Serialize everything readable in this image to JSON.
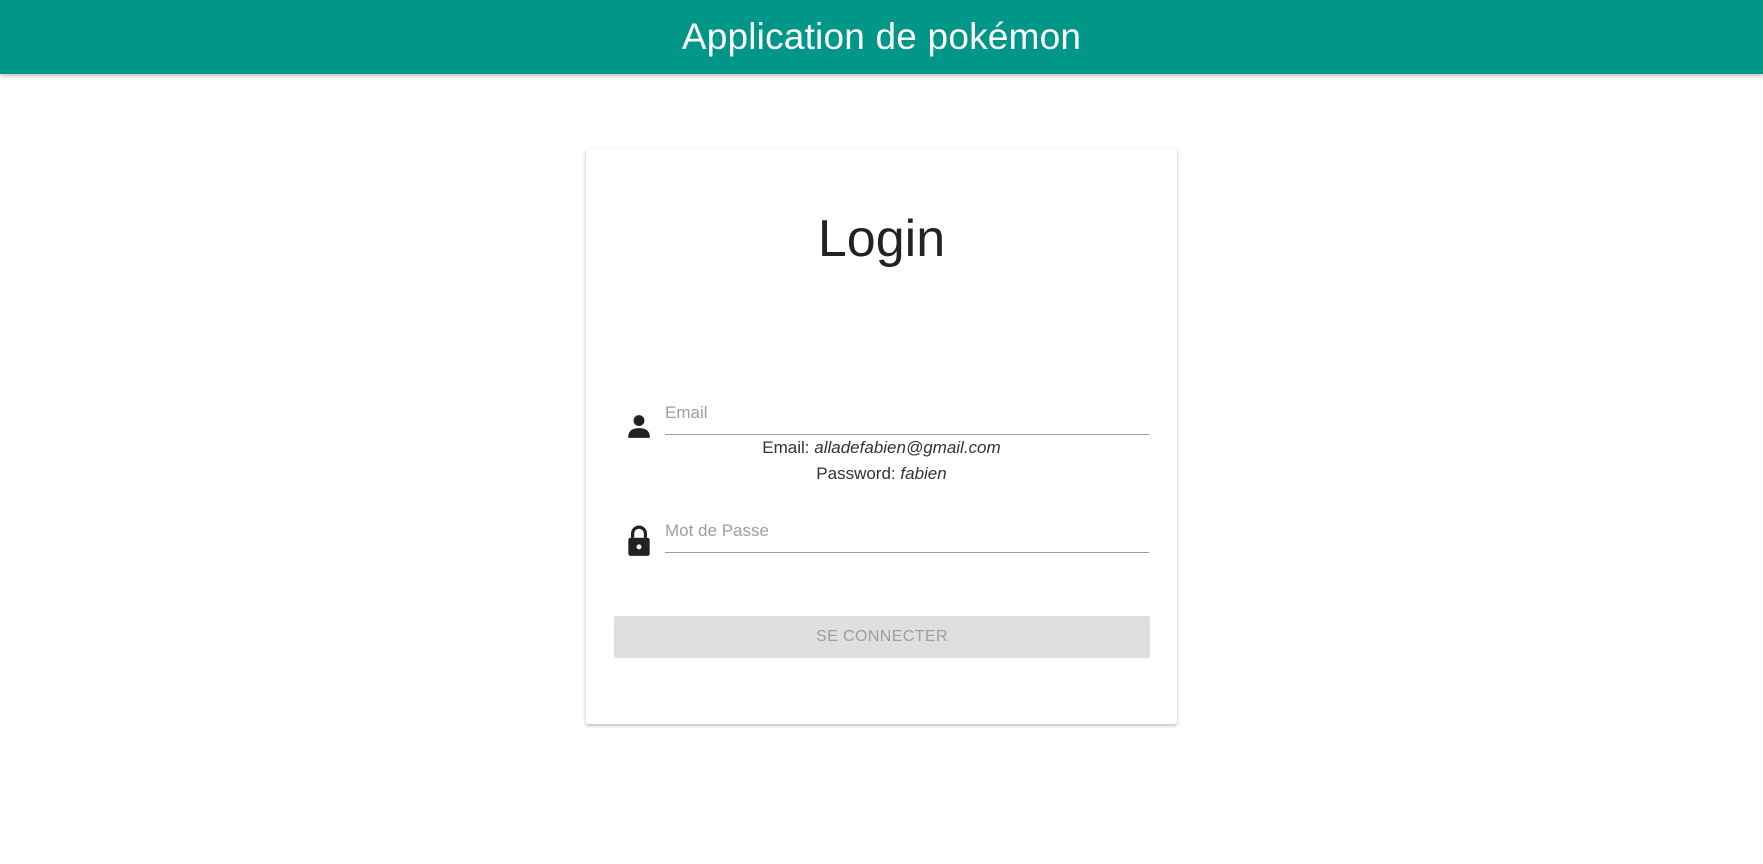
{
  "header": {
    "title": "Application de pokémon",
    "background_color": "#009688"
  },
  "login_card": {
    "title": "Login",
    "email_hint_label": "Email:",
    "email_hint_value": "alladefabien@gmail.com",
    "password_hint_label": "Password:",
    "password_hint_value": "fabien",
    "email_field": {
      "icon": "person-icon",
      "placeholder": "Email",
      "value": ""
    },
    "password_field": {
      "icon": "lock-icon",
      "placeholder": "Mot de Passe",
      "value": ""
    },
    "submit_label": "Se connecter",
    "submit_disabled": true
  }
}
